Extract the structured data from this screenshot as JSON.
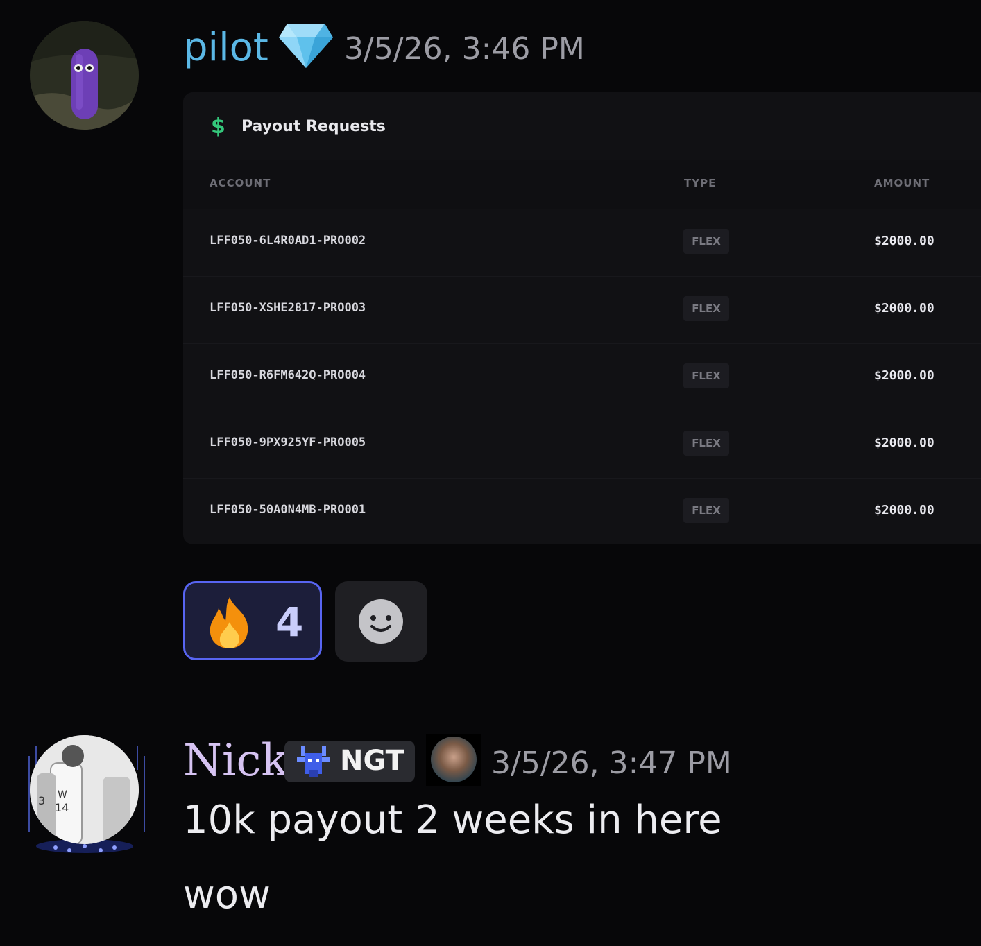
{
  "messages": [
    {
      "author": "pilot",
      "timestamp": "3/5/26, 3:46 PM",
      "badge_icon": "diamond-icon",
      "embed": {
        "title": "Payout Requests",
        "title_icon": "dollar-icon",
        "columns": [
          "ACCOUNT",
          "TYPE",
          "AMOUNT"
        ],
        "rows": [
          {
            "account": "LFF050-6L4R0AD1-PRO002",
            "type": "FLEX",
            "amount": "$2000.00"
          },
          {
            "account": "LFF050-XSHE2817-PRO003",
            "type": "FLEX",
            "amount": "$2000.00"
          },
          {
            "account": "LFF050-R6FM642Q-PRO004",
            "type": "FLEX",
            "amount": "$2000.00"
          },
          {
            "account": "LFF050-9PX925YF-PRO005",
            "type": "FLEX",
            "amount": "$2000.00"
          },
          {
            "account": "LFF050-50A0N4MB-PRO001",
            "type": "FLEX",
            "amount": "$2000.00"
          }
        ]
      },
      "reactions": [
        {
          "emoji": "fire-icon",
          "count": "4",
          "selected": true
        }
      ],
      "add_reaction_icon": "smile-icon"
    },
    {
      "author": "Nick",
      "tag": "NGT",
      "tag_icon": "goat-icon",
      "timestamp": "3/5/26, 3:47 PM",
      "lines": [
        "10k payout 2 weeks in here",
        "wow"
      ]
    }
  ],
  "colors": {
    "pilot_name": "#5bb8e6",
    "nick_name": "#d6c3f2",
    "reaction_border": "#5865f2",
    "dollar": "#34c77b"
  }
}
